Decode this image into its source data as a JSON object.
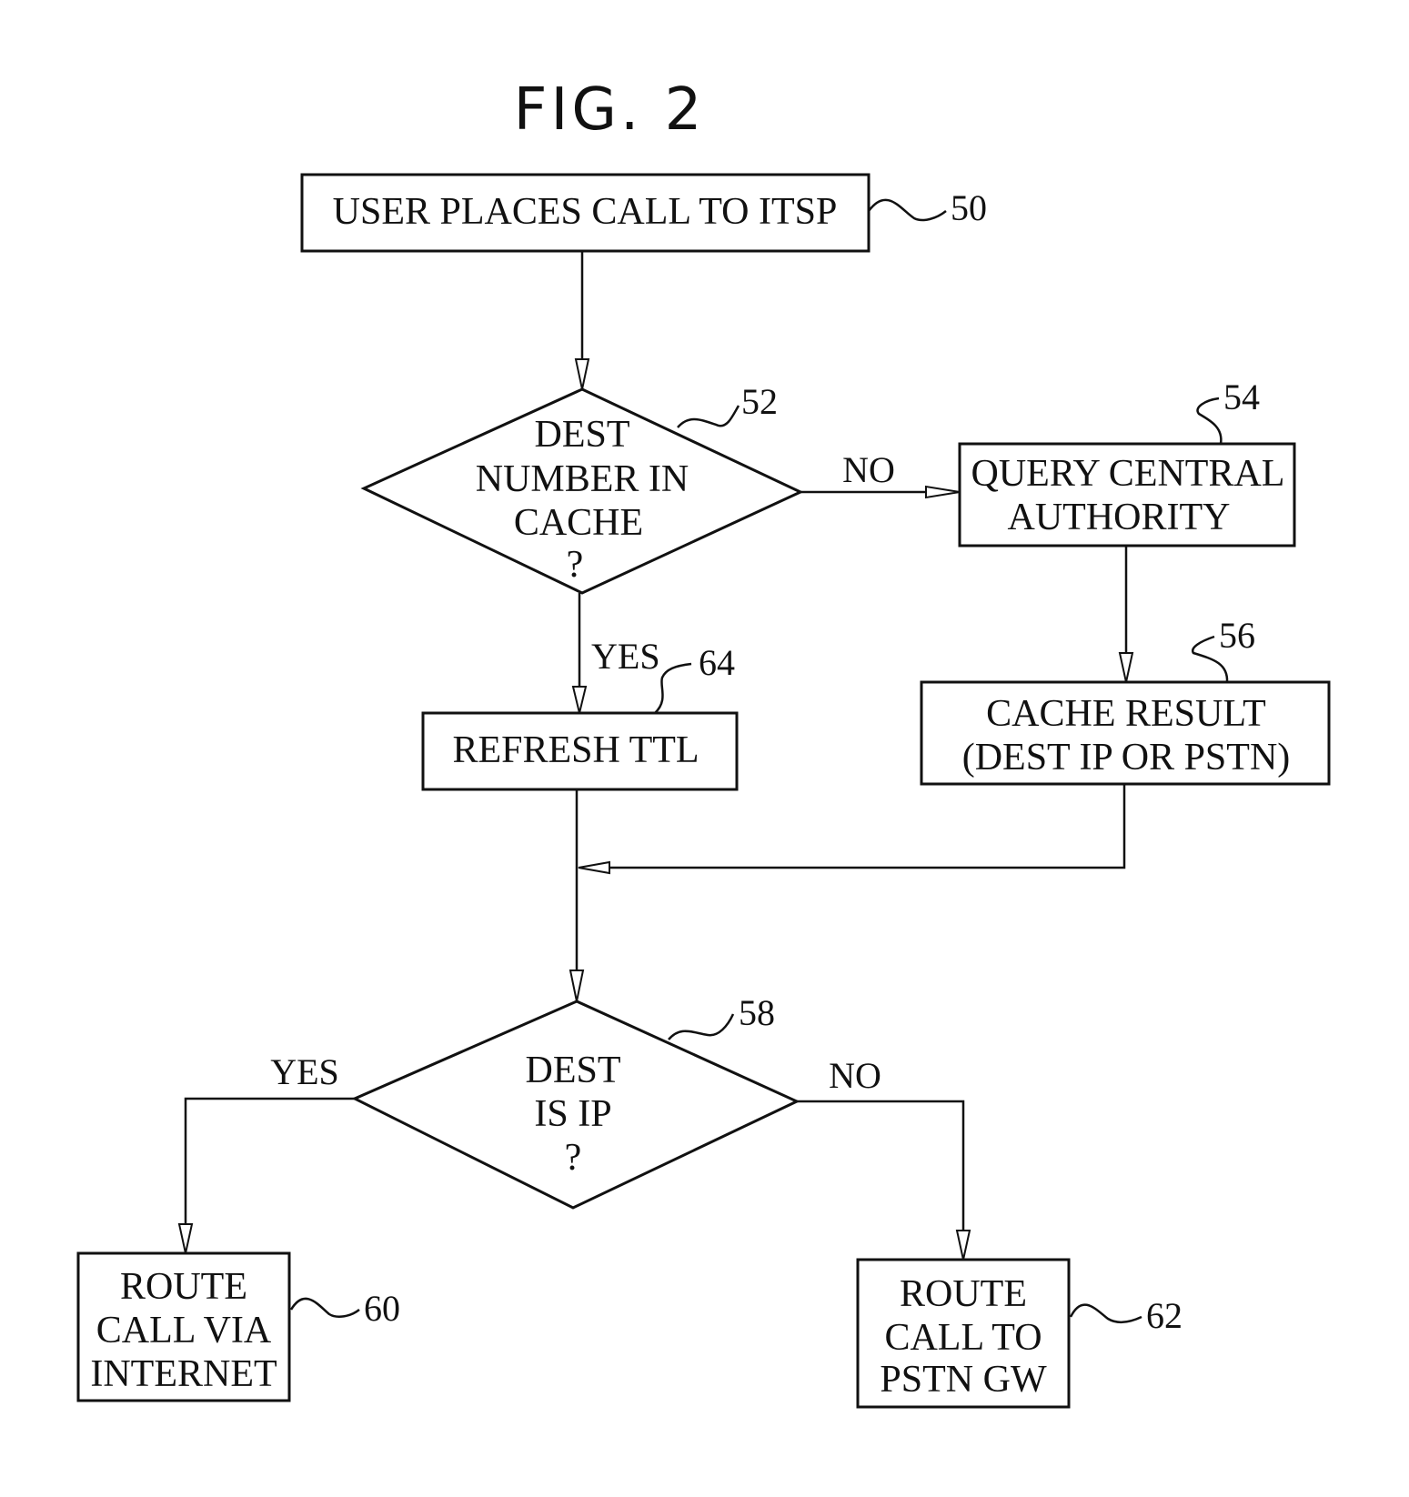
{
  "figure": {
    "title": "FIG. 2"
  },
  "nodes": {
    "n50": {
      "ref": "50",
      "type": "process",
      "lines": [
        "USER PLACES CALL TO ITSP"
      ]
    },
    "n52": {
      "ref": "52",
      "type": "decision",
      "lines": [
        "DEST",
        "NUMBER IN",
        "CACHE",
        "?"
      ]
    },
    "n54": {
      "ref": "54",
      "type": "process",
      "lines": [
        "QUERY CENTRAL",
        "AUTHORITY"
      ]
    },
    "n56": {
      "ref": "56",
      "type": "process",
      "lines": [
        "CACHE RESULT",
        "(DEST IP OR PSTN)"
      ]
    },
    "n64": {
      "ref": "64",
      "type": "process",
      "lines": [
        "REFRESH TTL"
      ]
    },
    "n58": {
      "ref": "58",
      "type": "decision",
      "lines": [
        "DEST",
        "IS IP",
        "?"
      ]
    },
    "n60": {
      "ref": "60",
      "type": "process",
      "lines": [
        "ROUTE",
        "CALL VIA",
        "INTERNET"
      ]
    },
    "n62": {
      "ref": "62",
      "type": "process",
      "lines": [
        "ROUTE",
        "CALL TO",
        "PSTN GW"
      ]
    }
  },
  "edges": [
    {
      "from": "50",
      "to": "52",
      "label": ""
    },
    {
      "from": "52",
      "to": "54",
      "label": "NO"
    },
    {
      "from": "52",
      "to": "64",
      "label": "YES"
    },
    {
      "from": "54",
      "to": "56",
      "label": ""
    },
    {
      "from": "56",
      "to": "58",
      "label": ""
    },
    {
      "from": "64",
      "to": "58",
      "label": ""
    },
    {
      "from": "58",
      "to": "60",
      "label": "YES"
    },
    {
      "from": "58",
      "to": "62",
      "label": "NO"
    }
  ],
  "labels": {
    "e52_no": "NO",
    "e52_yes": "YES",
    "e58_yes": "YES",
    "e58_no": "NO"
  }
}
